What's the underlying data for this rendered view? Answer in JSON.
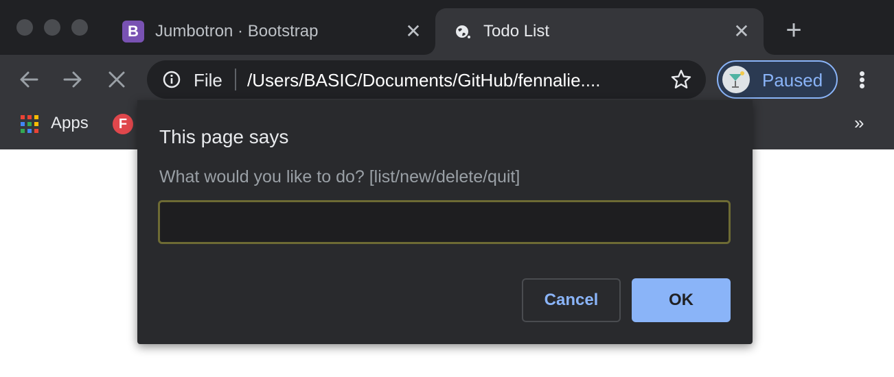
{
  "browser": {
    "tabs": [
      {
        "title": "Jumbotron · Bootstrap",
        "favicon": "bootstrap-icon",
        "favicon_text": "B",
        "active": false
      },
      {
        "title": "Todo List",
        "favicon": "globe-icon",
        "active": true
      }
    ],
    "omnibox": {
      "scheme_label": "File",
      "url": "/Users/BASIC/Documents/GitHub/fennalie...."
    },
    "profile": {
      "label": "Paused"
    },
    "bookmarks": {
      "apps_label": "Apps",
      "items": [
        {
          "badge": "F",
          "color": "#e0474c"
        }
      ],
      "overflow": "»"
    }
  },
  "dialog": {
    "title": "This page says",
    "message": "What would you like to do? [list/new/delete/quit]",
    "input_value": "",
    "cancel_label": "Cancel",
    "ok_label": "OK"
  },
  "colors": {
    "frame": "#202124",
    "toolbar": "#35363a",
    "dialog_bg": "#292a2d",
    "accent": "#8ab4f8",
    "input_border": "#6e6b34"
  }
}
